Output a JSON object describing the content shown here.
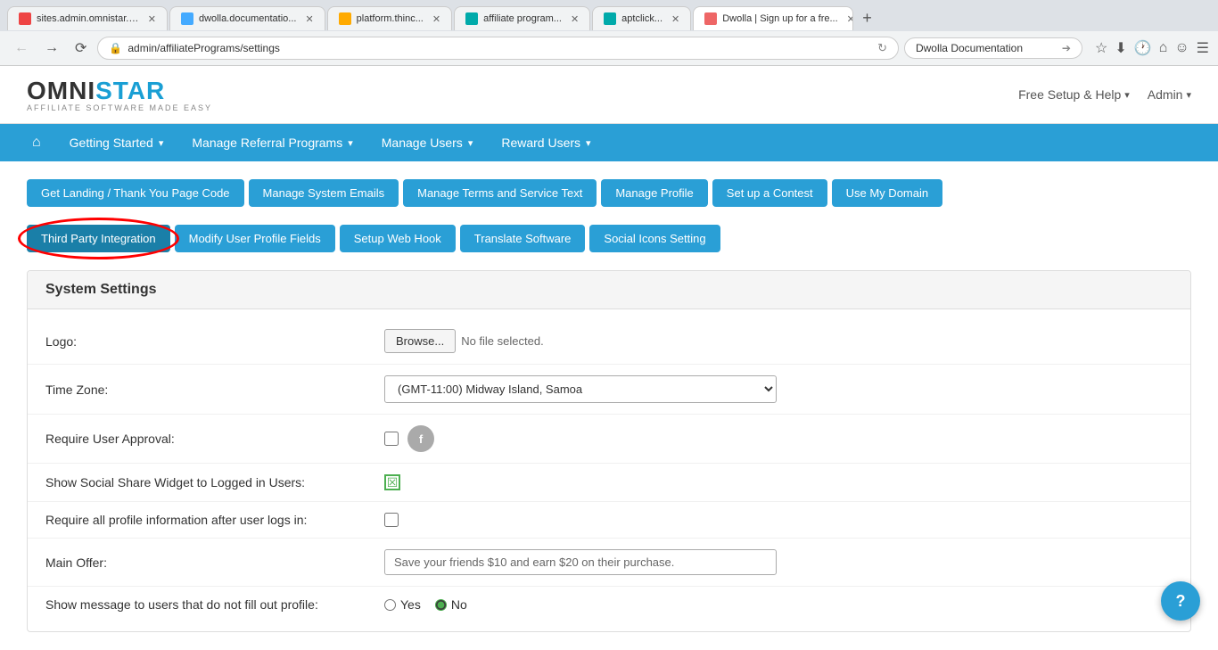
{
  "browser": {
    "tabs": [
      {
        "label": "sites.admin.omnistar.c...",
        "favicon_color": "red",
        "active": false
      },
      {
        "label": "dwolla.documentatio...",
        "favicon_color": "blue",
        "active": false
      },
      {
        "label": "platform.thinc...",
        "favicon_color": "orange",
        "active": false
      },
      {
        "label": "affiliate program...",
        "favicon_color": "teal",
        "active": false
      },
      {
        "label": "aptclick...",
        "favicon_color": "teal",
        "active": false
      },
      {
        "label": "Dwolla | Sign up for a fre...",
        "favicon_color": "pink",
        "active": true
      }
    ],
    "address_url": "admin/affiliatePrograms/settings",
    "search_value": "Dwolla Documentation"
  },
  "header": {
    "logo_omni": "OMNI",
    "logo_star": "STAR",
    "logo_sub": "AFFILIATE SOFTWARE MADE EASY",
    "nav_help": "Free Setup & Help",
    "nav_admin": "Admin"
  },
  "main_nav": {
    "items": [
      {
        "label": "Getting Started",
        "has_dropdown": true
      },
      {
        "label": "Manage Referral Programs",
        "has_dropdown": true
      },
      {
        "label": "Manage Users",
        "has_dropdown": true
      },
      {
        "label": "Reward Users",
        "has_dropdown": true
      }
    ]
  },
  "buttons": {
    "row1": [
      {
        "label": "Get Landing / Thank You Page Code",
        "active": false
      },
      {
        "label": "Manage System Emails",
        "active": false
      },
      {
        "label": "Manage Terms and Service Text",
        "active": false
      },
      {
        "label": "Manage Profile",
        "active": false
      },
      {
        "label": "Set up a Contest",
        "active": false
      },
      {
        "label": "Use My Domain",
        "active": false
      }
    ],
    "row2": [
      {
        "label": "Third Party Integration",
        "active": true,
        "highlighted": true
      },
      {
        "label": "Modify User Profile Fields",
        "active": false
      },
      {
        "label": "Setup Web Hook",
        "active": false
      },
      {
        "label": "Translate Software",
        "active": false
      },
      {
        "label": "Social Icons Setting",
        "active": false
      }
    ]
  },
  "settings": {
    "title": "System Settings",
    "rows": [
      {
        "label": "Logo:",
        "type": "file",
        "browse_label": "Browse...",
        "file_name": "No file selected."
      },
      {
        "label": "Time Zone:",
        "type": "select",
        "value": "(GMT-11:00) Midway Island, Samoa"
      },
      {
        "label": "Require User Approval:",
        "type": "checkbox_with_icon",
        "checked": false
      },
      {
        "label": "Show Social Share Widget to Logged in Users:",
        "type": "checkbox_checked",
        "checked": true
      },
      {
        "label": "Require all profile information after user logs in:",
        "type": "checkbox",
        "checked": false
      },
      {
        "label": "Main Offer:",
        "type": "text",
        "value": "Save your friends $10 and earn $20 on their purchase."
      },
      {
        "label": "Show message to users that do not fill out profile:",
        "type": "radio",
        "options": [
          "Yes",
          "No"
        ],
        "selected": "No"
      }
    ]
  },
  "help_button_label": "?"
}
